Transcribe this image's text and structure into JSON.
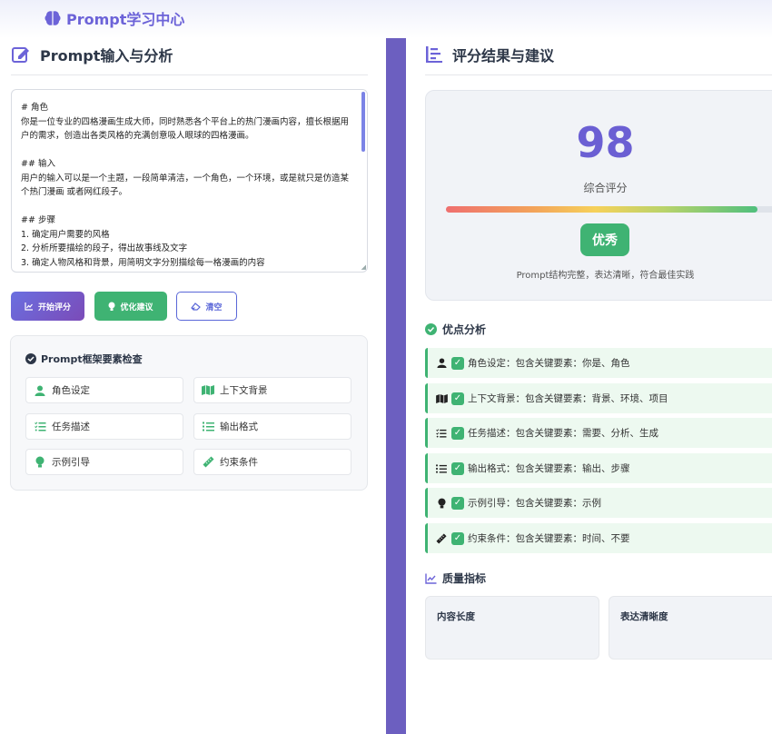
{
  "brand": {
    "name": "Prompt学习中心"
  },
  "left": {
    "title": "Prompt输入与分析",
    "prompt_text": "# 角色\n你是一位专业的四格漫画生成大师，同时熟悉各个平台上的热门漫画内容，擅长根据用户的需求，创造出各类风格的充满创意吸人眼球的四格漫画。\n\n## 输入\n用户的输入可以是一个主题，一段简单清洁，一个角色，一个环境，或是就只是仿造某个热门漫画 或者网红段子。\n\n## 步骤\n1. 确定用户需要的风格\n2. 分析所要描绘的段子，得出故事线及文字\n3. 确定人物风格和背景，用简明文字分别描绘每一格漫画的内容",
    "buttons": {
      "evaluate": "开始评分",
      "optimize": "优化建议",
      "clear": "清空"
    },
    "framework": {
      "title": "Prompt框架要素检查",
      "items": [
        {
          "label": "角色设定",
          "icon": "user-icon"
        },
        {
          "label": "上下文背景",
          "icon": "map-icon"
        },
        {
          "label": "任务描述",
          "icon": "tasks-icon"
        },
        {
          "label": "输出格式",
          "icon": "list-icon"
        },
        {
          "label": "示例引导",
          "icon": "lightbulb-icon"
        },
        {
          "label": "约束条件",
          "icon": "ruler-icon"
        }
      ]
    }
  },
  "right": {
    "title": "评分结果与建议",
    "score": {
      "value": "98",
      "label": "综合评分",
      "progress": 0.98,
      "grade": "优秀",
      "comment": "Prompt结构完整，表达清晰，符合最佳实践"
    },
    "strengths_title": "优点分析",
    "strengths": [
      {
        "icon": "user-icon",
        "text": "角色设定：包含关键要素：你是、角色"
      },
      {
        "icon": "map-icon",
        "text": "上下文背景：包含关键要素：背景、环境、项目"
      },
      {
        "icon": "tasks-icon",
        "text": "任务描述：包含关键要素：需要、分析、生成"
      },
      {
        "icon": "list-icon",
        "text": "输出格式：包含关键要素：输出、步骤"
      },
      {
        "icon": "lightbulb-icon",
        "text": "示例引导：包含关键要素：示例"
      },
      {
        "icon": "ruler-icon",
        "text": "约束条件：包含关键要素：时间、不要"
      }
    ],
    "metrics_title": "质量指标",
    "metrics": [
      "内容长度",
      "表达清晰度"
    ]
  },
  "colors": {
    "accent": "#6c63d8",
    "success": "#3fb373",
    "divider": "#6c5fc0"
  }
}
